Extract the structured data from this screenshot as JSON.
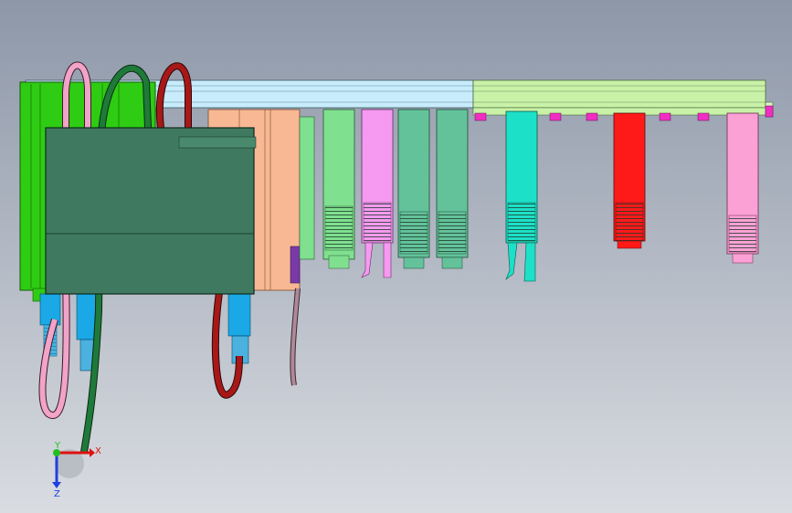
{
  "view": {
    "background_top": "#8d97a8",
    "background_bottom": "#d9dce1"
  },
  "colors": {
    "rail_light_blue": "#c8ecfb",
    "rail_light_green": "#c9f2a8",
    "module_green": "#2ecc12",
    "module_dark_green": "#3f7a60",
    "connector_peach": "#f8b894",
    "connector_light_green": "#7fe08f",
    "connector_pink": "#f59af0",
    "connector_sea_green": "#63c29a",
    "connector_teal": "#1de0c8",
    "connector_red": "#ff1a1a",
    "connector_light_pink": "#fba1d6",
    "connector_purple": "#b14ad8",
    "connector_blue": "#1aa8e6",
    "magenta_clip": "#f02fc2",
    "cable_pink": "#f2a3c8",
    "cable_dark_green": "#1f7a3a",
    "cable_dark_red": "#a81818",
    "cable_mauve": "#b08898",
    "axis_x": "#e01010",
    "axis_y": "#20c020",
    "axis_z": "#2040e0"
  },
  "triad": {
    "x_label": "X",
    "y_label": "Y",
    "z_label": "Z"
  }
}
